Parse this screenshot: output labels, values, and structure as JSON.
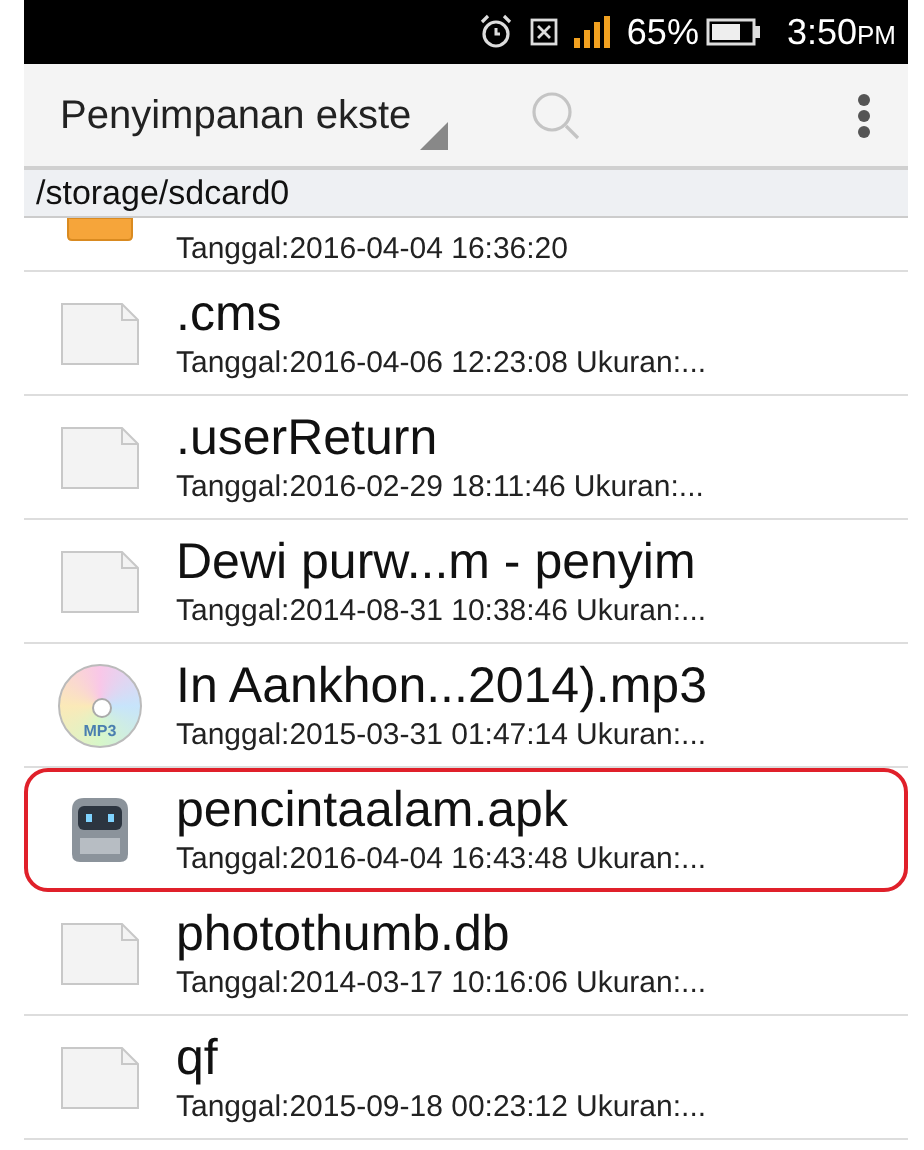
{
  "status_bar": {
    "battery": "65%",
    "time": "3:50",
    "time_suffix": "PM"
  },
  "toolbar": {
    "title": "Penyimpanan ekste"
  },
  "path": "/storage/sdcard0",
  "files": [
    {
      "kind": "folder",
      "date": "Tanggal:2016-04-04 16:36:20",
      "highlighted": false
    },
    {
      "kind": "file",
      "name": ".cms",
      "date": "Tanggal:2016-04-06 12:23:08",
      "size": "Ukuran:...",
      "highlighted": false
    },
    {
      "kind": "file",
      "name": ".userReturn",
      "date": "Tanggal:2016-02-29 18:11:46",
      "size": "Ukuran:...",
      "highlighted": false
    },
    {
      "kind": "file",
      "name": "Dewi purw...m - penyim",
      "date": "Tanggal:2014-08-31 10:38:46",
      "size": "Ukuran:...",
      "highlighted": false
    },
    {
      "kind": "audio",
      "icon_text": "MP3",
      "name": "In Aankhon...2014).mp3",
      "date": "Tanggal:2015-03-31 01:47:14",
      "size": "Ukuran:...",
      "highlighted": false
    },
    {
      "kind": "apk",
      "name": "pencintaalam.apk",
      "date": "Tanggal:2016-04-04 16:43:48",
      "size": "Ukuran:...",
      "highlighted": true
    },
    {
      "kind": "file",
      "name": "photothumb.db",
      "date": "Tanggal:2014-03-17 10:16:06",
      "size": "Ukuran:...",
      "highlighted": false
    },
    {
      "kind": "file",
      "name": "qf",
      "date": "Tanggal:2015-09-18 00:23:12",
      "size": "Ukuran:...",
      "highlighted": false
    }
  ]
}
